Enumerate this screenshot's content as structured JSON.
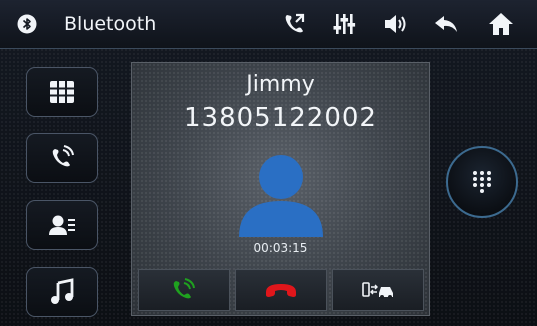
{
  "header": {
    "title": "Bluetooth",
    "icons": [
      "bluetooth-icon",
      "call-icon",
      "equalizer-icon",
      "volume-icon",
      "back-icon",
      "home-icon"
    ]
  },
  "nav": {
    "items": [
      "keypad",
      "call-log",
      "contacts",
      "music"
    ],
    "active": "keypad"
  },
  "call": {
    "name": "Jimmy",
    "number": "13805122002",
    "duration": "00:03:15",
    "actions": [
      "answer",
      "hang-up",
      "transfer-to-phone"
    ]
  },
  "colors": {
    "answer": "#1fa11f",
    "hangup": "#e0161b",
    "avatar": "#2a6fc4",
    "accent": "#3c6a8f"
  }
}
